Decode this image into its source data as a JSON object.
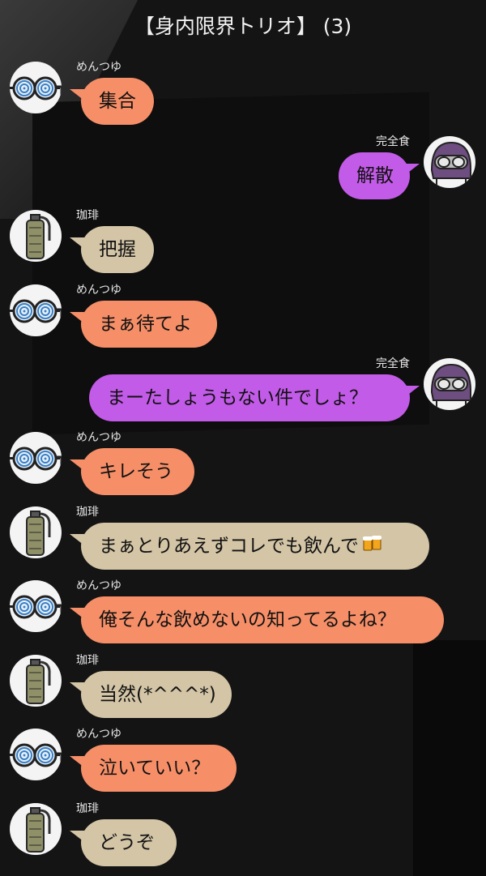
{
  "header": {
    "title": "【身内限界トリオ】 (3)"
  },
  "colors": {
    "background": "#141414",
    "menntsuyu_bubble": "#f68f68",
    "kouhi_bubble": "#d3c5a6",
    "kanzenshoku_bubble": "#c25be7"
  },
  "messages": [
    {
      "sender": "めんつゆ",
      "text": "集合",
      "avatar_icon": "swirl-glasses-icon"
    },
    {
      "sender": "完全食",
      "text": "解散",
      "avatar_icon": "goggle-helmet-icon"
    },
    {
      "sender": "珈琲",
      "text": "把握",
      "avatar_icon": "grenade-bottle-icon"
    },
    {
      "sender": "めんつゆ",
      "text": "まぁ待てよ",
      "avatar_icon": "swirl-glasses-icon"
    },
    {
      "sender": "完全食",
      "text": "まーたしょうもない件でしょ？",
      "avatar_icon": "goggle-helmet-icon"
    },
    {
      "sender": "めんつゆ",
      "text": "キレそう",
      "avatar_icon": "swirl-glasses-icon"
    },
    {
      "sender": "珈琲",
      "text": "まぁとりあえずコレでも飲んで",
      "emoji": "beer-mugs-icon",
      "avatar_icon": "grenade-bottle-icon"
    },
    {
      "sender": "めんつゆ",
      "text": "俺そんな飲めないの知ってるよね？",
      "avatar_icon": "swirl-glasses-icon"
    },
    {
      "sender": "珈琲",
      "text": "当然(*^^^*)",
      "avatar_icon": "grenade-bottle-icon"
    },
    {
      "sender": "めんつゆ",
      "text": "泣いていい？",
      "avatar_icon": "swirl-glasses-icon"
    },
    {
      "sender": "珈琲",
      "text": "どうぞ",
      "avatar_icon": "grenade-bottle-icon"
    }
  ]
}
